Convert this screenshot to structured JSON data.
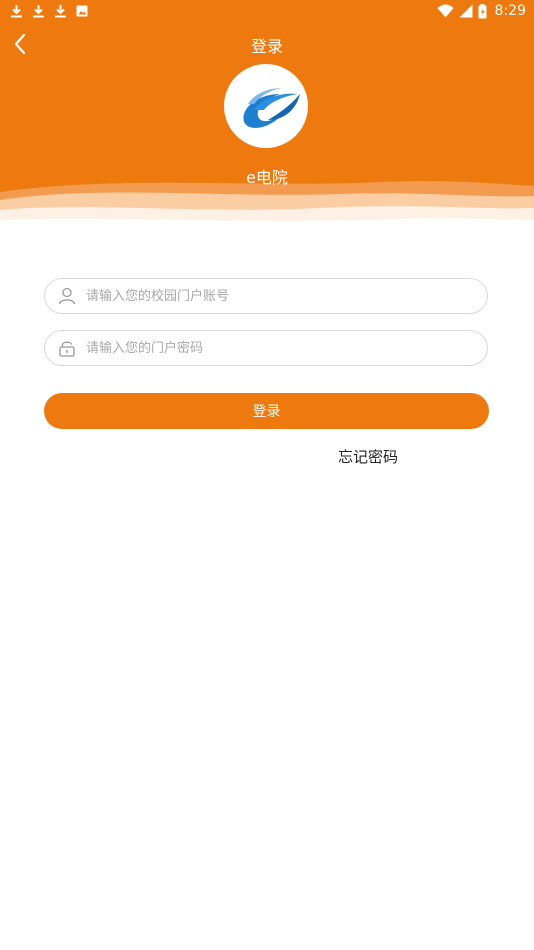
{
  "status_bar": {
    "time": "8:29",
    "notification_icons": [
      "download-icon",
      "download-icon",
      "download-icon",
      "image-icon"
    ],
    "system_icons": [
      "wifi-icon",
      "signal-icon",
      "battery-icon"
    ]
  },
  "header": {
    "title": "登录",
    "app_name": "e电院",
    "background_color": "#ee790f"
  },
  "form": {
    "username": {
      "placeholder": "请输入您的校园门户账号",
      "value": ""
    },
    "password": {
      "placeholder": "请输入您的门户密码",
      "value": ""
    },
    "login_label": "登录",
    "forgot_label": "忘记密码"
  },
  "colors": {
    "accent": "#ee790f",
    "logo_blue": "#1e7fd0"
  }
}
